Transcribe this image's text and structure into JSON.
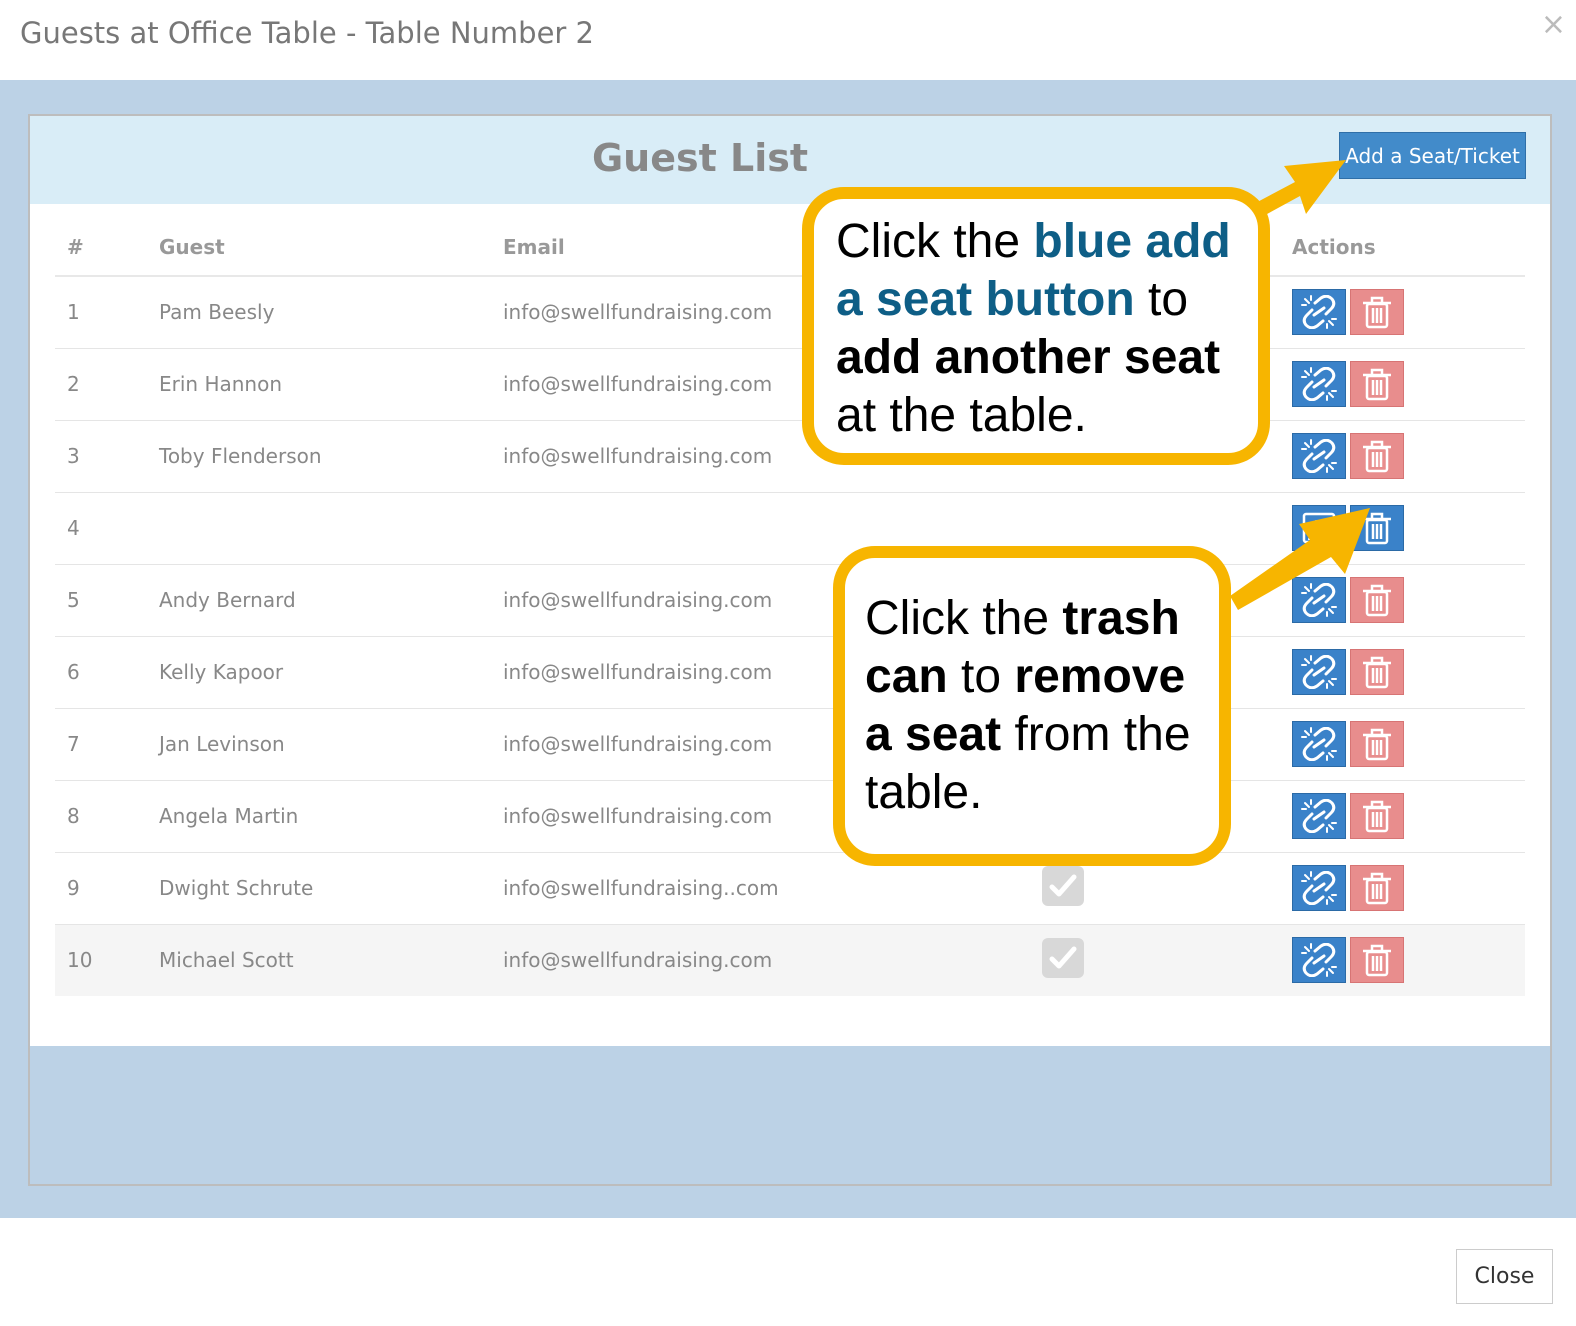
{
  "header": {
    "title": "Guests at Office Table - Table Number 2",
    "close_glyph": "×"
  },
  "panel": {
    "title": "Guest List",
    "add_button": "Add a Seat/Ticket"
  },
  "table": {
    "columns": {
      "num": "#",
      "guest": "Guest",
      "email": "Email",
      "actions": "Actions"
    },
    "rows": [
      {
        "num": "1",
        "guest": "Pam Beesly",
        "email": "info@swellfundraising.com"
      },
      {
        "num": "2",
        "guest": "Erin Hannon",
        "email": "info@swellfundraising.com"
      },
      {
        "num": "3",
        "guest": "Toby Flenderson",
        "email": "info@swellfundraising.com"
      },
      {
        "num": "4",
        "guest": "",
        "email": ""
      },
      {
        "num": "5",
        "guest": "Andy Bernard",
        "email": "info@swellfundraising.com"
      },
      {
        "num": "6",
        "guest": "Kelly Kapoor",
        "email": "info@swellfundraising.com"
      },
      {
        "num": "7",
        "guest": "Jan Levinson",
        "email": "info@swellfundraising.com"
      },
      {
        "num": "8",
        "guest": "Angela Martin",
        "email": "info@swellfundraising.com"
      },
      {
        "num": "9",
        "guest": "Dwight Schrute",
        "email": "info@swellfundraising..com"
      },
      {
        "num": "10",
        "guest": "Michael Scott",
        "email": "info@swellfundraising.com"
      }
    ]
  },
  "callouts": {
    "add": {
      "p1": "Click the ",
      "p2": "blue add a seat button",
      "p3": " to ",
      "p4": "add another seat",
      "p5": " at the table."
    },
    "trash": {
      "p1": "Click the ",
      "p2": "trash can",
      "p3": " to ",
      "p4": "remove a seat",
      "p5": " from the table."
    }
  },
  "footer": {
    "close_button": "Close"
  },
  "colors": {
    "accent": "#428bca",
    "danger": "#e88d8d",
    "callout_border": "#f7b500",
    "highlight": "#0e5e86",
    "body_bg": "#bcd2e6"
  },
  "icons": {
    "unlink": "unlink-icon",
    "trash": "trash-icon",
    "assign": "assign-user-icon",
    "check": "check-icon"
  }
}
